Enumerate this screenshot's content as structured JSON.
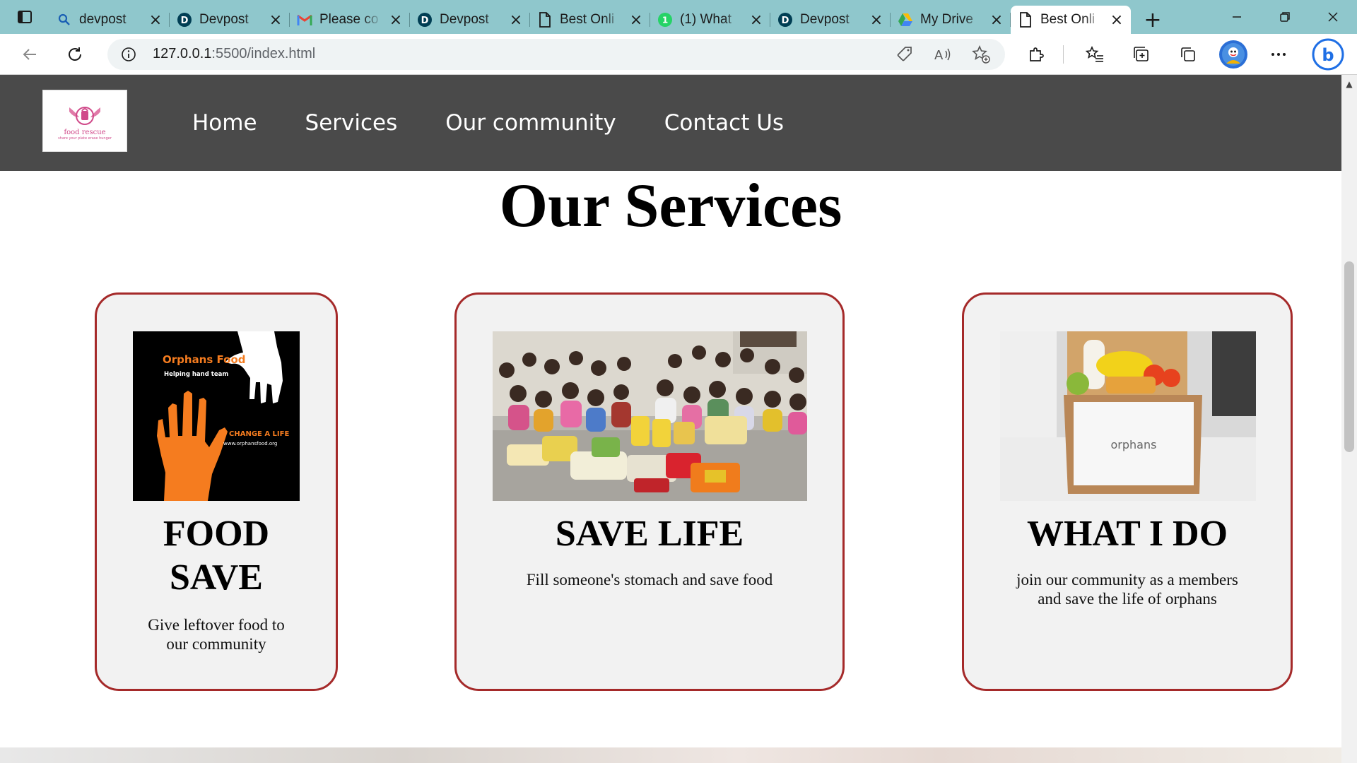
{
  "browser": {
    "tabs": [
      {
        "title": "devpost",
        "icon": "search-icon",
        "active": false
      },
      {
        "title": "Devpost",
        "icon": "devpost-icon",
        "active": false
      },
      {
        "title": "Please co",
        "icon": "gmail-icon",
        "active": false
      },
      {
        "title": "Devpost",
        "icon": "devpost-icon",
        "active": false
      },
      {
        "title": "Best Onli",
        "icon": "page-icon",
        "active": false
      },
      {
        "title": "(1) What",
        "icon": "whatsapp-icon",
        "active": false
      },
      {
        "title": "Devpost",
        "icon": "devpost-icon",
        "active": false
      },
      {
        "title": "My Drive",
        "icon": "drive-icon",
        "active": false
      },
      {
        "title": "Best Onli",
        "icon": "page-icon",
        "active": true
      }
    ],
    "address": {
      "host": "127.0.0.1",
      "rest": ":5500/index.html"
    },
    "colors": {
      "tabstrip": "#8fc7cc",
      "toolbar": "#ffffff"
    }
  },
  "site": {
    "logo": {
      "name": "food rescue",
      "tagline": "share your plate erase hunger"
    },
    "nav": [
      "Home",
      "Services",
      "Our community",
      "Contact Us"
    ],
    "header_color": "#4a4a4a",
    "section_title": "Our Services",
    "cards": [
      {
        "title_line1": "FOOD",
        "title_line2": "SAVE",
        "text_line1": "Give leftover food to",
        "text_line2": "our community",
        "image": {
          "headline": "Orphans Food",
          "sub": "Helping hand team",
          "cta": "CHANGE A LIFE",
          "url": "www.orphansfood.org"
        }
      },
      {
        "title_line1": "SAVE LIFE",
        "text_line1": "Fill someone's stomach and save food",
        "image": {
          "alt": "children-with-food-donations"
        }
      },
      {
        "title_line1": "WHAT I DO",
        "text_line1": "join our community as a members",
        "text_line2": "and save the life of orphans",
        "image": {
          "box_label": "orphans"
        }
      }
    ],
    "card_border_color": "#a52a2a"
  }
}
